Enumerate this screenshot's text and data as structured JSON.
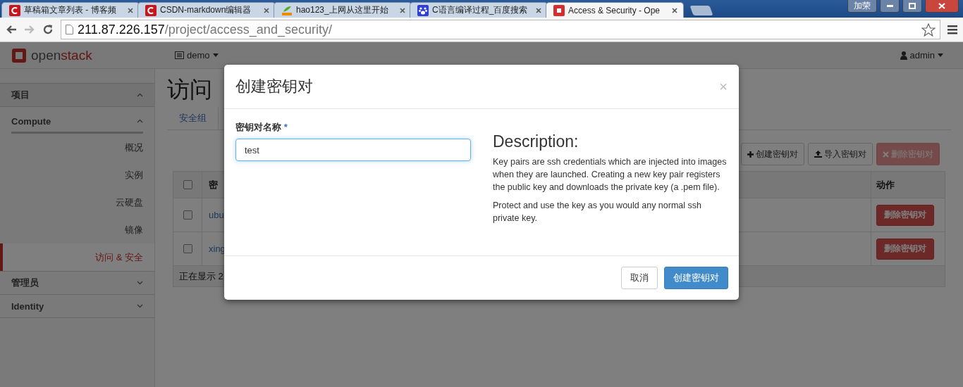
{
  "browser": {
    "tabs": [
      {
        "title": "草稿箱文章列表 - 博客频",
        "selected": false,
        "kind": "csdn"
      },
      {
        "title": "CSDN-markdown编辑器",
        "selected": false,
        "kind": "csdn"
      },
      {
        "title": "hao123_上网从这里开始",
        "selected": false,
        "kind": "hao"
      },
      {
        "title": "C语言编译过程_百度搜索",
        "selected": false,
        "kind": "paw"
      },
      {
        "title": "Access & Security - Ope",
        "selected": true,
        "kind": "openstack"
      }
    ],
    "window_badge": "加荣",
    "address": {
      "host": "211.87.226.157",
      "path": "/project/access_and_security/"
    }
  },
  "header": {
    "brand_prefix": "open",
    "brand_suffix": "stack",
    "project": "demo",
    "user": "admin"
  },
  "sidebar": [
    {
      "label": "项目",
      "expanded": true,
      "children": [
        {
          "label": "Compute",
          "expanded": true,
          "children": [
            {
              "label": "概况",
              "selected": false
            },
            {
              "label": "实例",
              "selected": false
            },
            {
              "label": "云硬盘",
              "selected": false
            },
            {
              "label": "镜像",
              "selected": false
            },
            {
              "label": "访问 & 安全",
              "selected": true
            }
          ]
        }
      ]
    },
    {
      "label": "管理员",
      "expanded": false
    },
    {
      "label": "Identity",
      "expanded": false
    }
  ],
  "page": {
    "title": "访问",
    "tabs": [
      {
        "label": "安全组",
        "selected": false
      }
    ],
    "actions": [
      {
        "label": "创建密钥对",
        "kind": "create",
        "disabled": false
      },
      {
        "label": "导入密钥对",
        "kind": "import",
        "disabled": false
      },
      {
        "label": "删除密钥对",
        "kind": "delete",
        "disabled": true
      }
    ],
    "table": {
      "select_all": {
        "checked": false
      },
      "columns": [
        "密",
        "动作"
      ],
      "rows": [
        {
          "name": "ubu",
          "action": "删除密钥对",
          "checked": false
        },
        {
          "name": "xing",
          "action": "删除密钥对",
          "checked": false
        }
      ],
      "footer": "正在显示 2"
    }
  },
  "modal": {
    "title": "创建密钥对",
    "close": "×",
    "field": {
      "label": "密钥对名称",
      "required_mark": "*",
      "value": "test"
    },
    "description_title": "Description:",
    "paragraphs": [
      "Key pairs are ssh credentials which are injected into images when they are launched. Creating a new key pair registers the public key and downloads the private key (a .pem file).",
      "Protect and use the key as you would any normal ssh private key."
    ],
    "buttons": [
      {
        "label": "取消",
        "kind": "default"
      },
      {
        "label": "创建密钥对",
        "kind": "primary"
      }
    ]
  }
}
